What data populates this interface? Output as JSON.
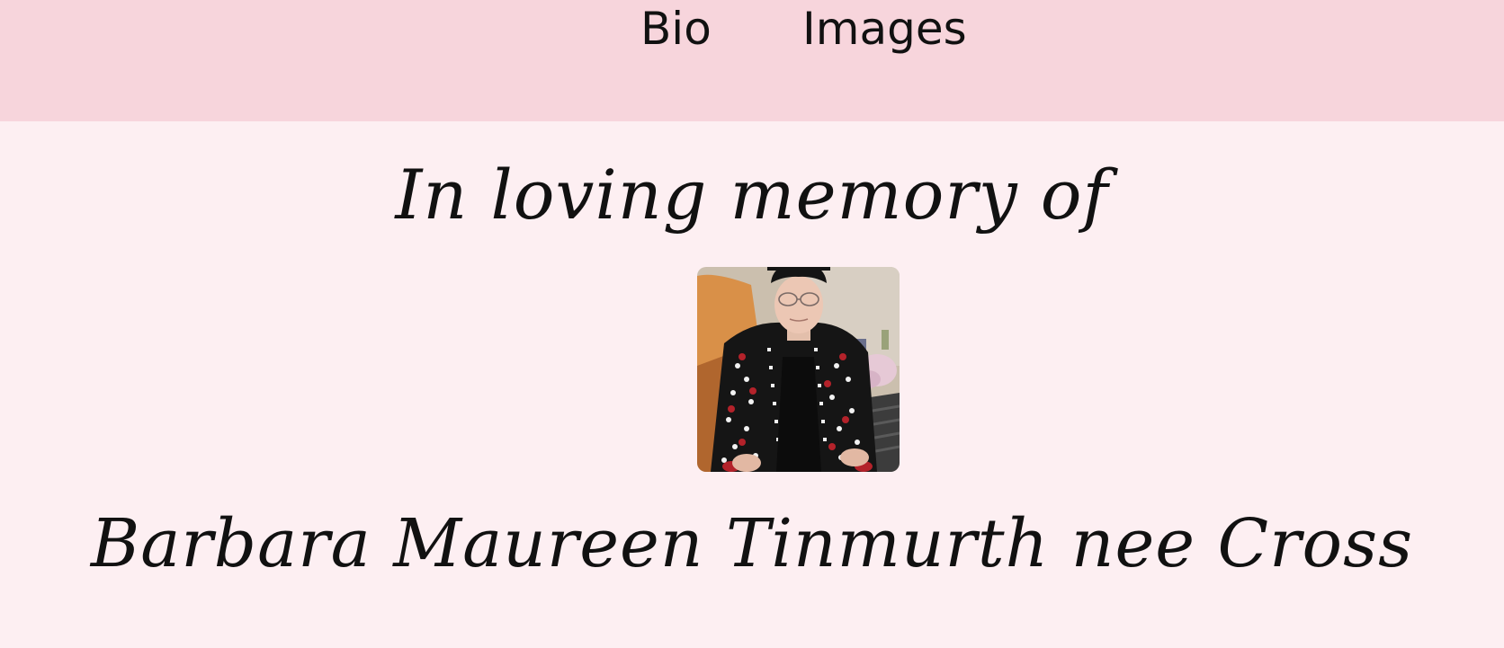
{
  "nav": {
    "items": [
      {
        "label": "Bio"
      },
      {
        "label": "Images"
      }
    ]
  },
  "memorial": {
    "intro": "In loving memory of",
    "name": "Barbara Maureen Tinmurth nee Cross",
    "photo": {
      "subject": "portrait of elderly woman in black hat and patterned cardigan"
    }
  },
  "colors": {
    "nav_background": "#f7d5dc",
    "page_background": "#fdeff2",
    "text": "#111111"
  }
}
